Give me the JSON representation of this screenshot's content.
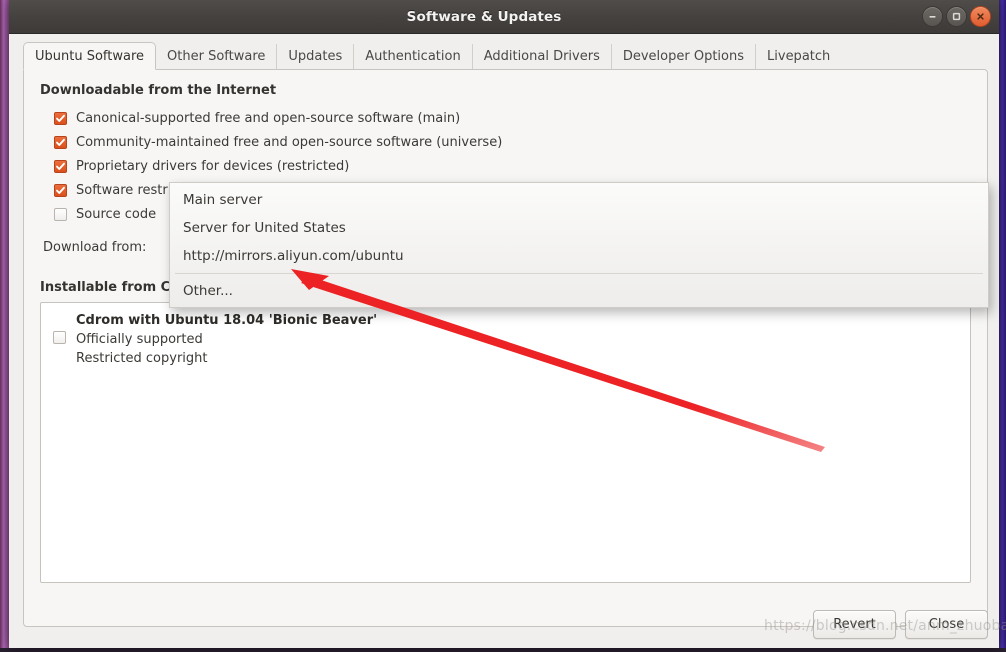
{
  "window": {
    "title": "Software & Updates",
    "controls": [
      {
        "name": "minimize",
        "glyph": "minimize-icon"
      },
      {
        "name": "maximize",
        "glyph": "maximize-icon"
      },
      {
        "name": "close",
        "glyph": "close-icon"
      }
    ]
  },
  "tabs": [
    {
      "label": "Ubuntu Software",
      "active": true
    },
    {
      "label": "Other Software",
      "active": false
    },
    {
      "label": "Updates",
      "active": false
    },
    {
      "label": "Authentication",
      "active": false
    },
    {
      "label": "Additional Drivers",
      "active": false
    },
    {
      "label": "Developer Options",
      "active": false
    },
    {
      "label": "Livepatch",
      "active": false
    }
  ],
  "internet_section": {
    "title": "Downloadable from the Internet",
    "checkboxes": [
      {
        "label": "Canonical-supported free and open-source software (main)",
        "checked": true
      },
      {
        "label": "Community-maintained free and open-source software (universe)",
        "checked": true
      },
      {
        "label": "Proprietary drivers for devices (restricted)",
        "checked": true
      },
      {
        "label": "Software restricted by copyright or legal issues (multiverse)",
        "checked": true
      },
      {
        "label": "Source code",
        "checked": false
      }
    ],
    "download_from_label": "Download from:",
    "download_from_value": "http://mirrors.aliyun.com/ubuntu"
  },
  "dropdown": {
    "items": [
      {
        "label": "Main server",
        "separator_before": false
      },
      {
        "label": "Server for United States",
        "separator_before": false
      },
      {
        "label": "http://mirrors.aliyun.com/ubuntu",
        "separator_before": false
      },
      {
        "label": "Other...",
        "separator_before": true
      }
    ]
  },
  "cdrom_section": {
    "title": "Installable from CD-ROM/DVD",
    "item": {
      "name": "Cdrom with Ubuntu 18.04 'Bionic Beaver'",
      "line2": "Officially supported",
      "line3": "Restricted copyright",
      "checked": false
    }
  },
  "buttons": {
    "revert": "Revert",
    "close": "Close"
  },
  "watermark": "https://blog.csdn.net/anm_zhuoban",
  "colors": {
    "accent_orange": "#d9501d",
    "titlebar": "#464341",
    "panel_bg": "#f7f6f5",
    "arrow_red": "#ec2224"
  }
}
